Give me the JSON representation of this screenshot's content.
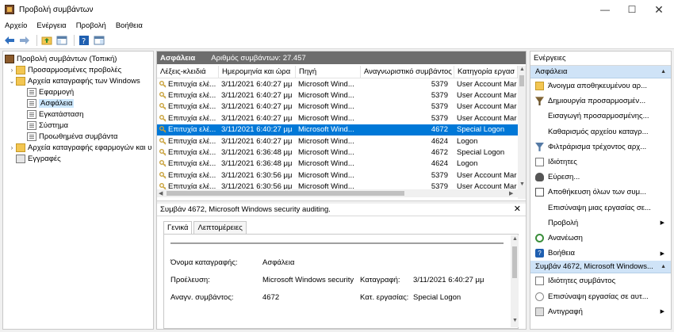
{
  "window": {
    "title": "Προβολή συμβάντων"
  },
  "menu": [
    "Αρχείο",
    "Ενέργεια",
    "Προβολή",
    "Βοήθεια"
  ],
  "tree": [
    {
      "label": "Προβολή συμβάντων (Τοπική)",
      "level": 0,
      "expander": "",
      "icon": "root"
    },
    {
      "label": "Προσαρμοσμένες προβολές",
      "level": 1,
      "expander": "›",
      "icon": "folder"
    },
    {
      "label": "Αρχεία καταγραφής των Windows",
      "level": 1,
      "expander": "⌄",
      "icon": "folder"
    },
    {
      "label": "Εφαρμογή",
      "level": 2,
      "expander": "",
      "icon": "log"
    },
    {
      "label": "Ασφάλεια",
      "level": 2,
      "expander": "",
      "icon": "log",
      "selected": true
    },
    {
      "label": "Εγκατάσταση",
      "level": 2,
      "expander": "",
      "icon": "log"
    },
    {
      "label": "Σύστημα",
      "level": 2,
      "expander": "",
      "icon": "log"
    },
    {
      "label": "Προωθημένα συμβάντα",
      "level": 2,
      "expander": "",
      "icon": "log"
    },
    {
      "label": "Αρχεία καταγραφής εφαρμογών και υ",
      "level": 1,
      "expander": "›",
      "icon": "folder"
    },
    {
      "label": "Εγγραφές",
      "level": 1,
      "expander": "",
      "icon": "filter"
    }
  ],
  "log_header": {
    "title": "Ασφάλεια",
    "count": "Αριθμός συμβάντων: 27.457"
  },
  "columns": [
    "Λέξεις-κλειδιά",
    "Ημερομηνία και ώρα",
    "Πηγή",
    "Αναγνωριστικό συμβάντος",
    "Κατηγορία εργασ"
  ],
  "events": [
    {
      "kw": "Επιτυχία ελέ...",
      "dt": "3/11/2021 6:40:27 μμ",
      "src": "Microsoft Wind...",
      "id": "5379",
      "cat": "User Account Mar"
    },
    {
      "kw": "Επιτυχία ελέ...",
      "dt": "3/11/2021 6:40:27 μμ",
      "src": "Microsoft Wind...",
      "id": "5379",
      "cat": "User Account Mar"
    },
    {
      "kw": "Επιτυχία ελέ...",
      "dt": "3/11/2021 6:40:27 μμ",
      "src": "Microsoft Wind...",
      "id": "5379",
      "cat": "User Account Mar"
    },
    {
      "kw": "Επιτυχία ελέ...",
      "dt": "3/11/2021 6:40:27 μμ",
      "src": "Microsoft Wind...",
      "id": "5379",
      "cat": "User Account Mar"
    },
    {
      "kw": "Επιτυχία ελέ...",
      "dt": "3/11/2021 6:40:27 μμ",
      "src": "Microsoft Wind...",
      "id": "4672",
      "cat": "Special Logon",
      "selected": true
    },
    {
      "kw": "Επιτυχία ελέ...",
      "dt": "3/11/2021 6:40:27 μμ",
      "src": "Microsoft Wind...",
      "id": "4624",
      "cat": "Logon"
    },
    {
      "kw": "Επιτυχία ελέ...",
      "dt": "3/11/2021 6:36:48 μμ",
      "src": "Microsoft Wind...",
      "id": "4672",
      "cat": "Special Logon"
    },
    {
      "kw": "Επιτυχία ελέ...",
      "dt": "3/11/2021 6:36:48 μμ",
      "src": "Microsoft Wind...",
      "id": "4624",
      "cat": "Logon"
    },
    {
      "kw": "Επιτυχία ελέ...",
      "dt": "3/11/2021 6:30:56 μμ",
      "src": "Microsoft Wind...",
      "id": "5379",
      "cat": "User Account Mar"
    },
    {
      "kw": "Επιτυχία ελέ...",
      "dt": "3/11/2021 6:30:56 μμ",
      "src": "Microsoft Wind...",
      "id": "5379",
      "cat": "User Account Mar"
    }
  ],
  "detail": {
    "title": "Συμβάν 4672, Microsoft Windows security auditing.",
    "tabs": [
      "Γενικά",
      "Λεπτομέρειες"
    ],
    "fields": {
      "logname_label": "Όνομα καταγραφής:",
      "logname_value": "Ασφάλεια",
      "source_label": "Προέλευση:",
      "source_value": "Microsoft Windows security a",
      "logged_label": "Καταγραφή:",
      "logged_value": "3/11/2021 6:40:27 μμ",
      "eventid_label": "Αναγν. συμβάντος:",
      "eventid_value": "4672",
      "category_label": "Κατ. εργασίας:",
      "category_value": "Special Logon"
    }
  },
  "actions": {
    "title": "Ενέργειες",
    "section1": "Ασφάλεια",
    "items1": [
      {
        "label": "Άνοιγμα αποθηκευμένου αρ...",
        "icon": "open",
        "more": false
      },
      {
        "label": "Δημιουργία προσαρμοσμέν...",
        "icon": "filt",
        "more": false
      },
      {
        "label": "Εισαγωγή προσαρμοσμένης...",
        "icon": "blank",
        "more": false
      },
      {
        "label": "Καθαρισμός αρχείου καταγρ...",
        "icon": "blank",
        "more": false
      },
      {
        "label": "Φιλτράρισμα τρέχοντος αρχ...",
        "icon": "filt2",
        "more": false
      },
      {
        "label": "Ιδιότητες",
        "icon": "props",
        "more": false
      },
      {
        "label": "Εύρεση...",
        "icon": "find",
        "more": false
      },
      {
        "label": "Αποθήκευση όλων των συμ...",
        "icon": "save",
        "more": false
      },
      {
        "label": "Επισύναψη μιας εργασίας σε...",
        "icon": "blank",
        "more": false
      },
      {
        "label": "Προβολή",
        "icon": "blank",
        "more": true
      },
      {
        "label": "Ανανέωση",
        "icon": "refresh",
        "more": false
      },
      {
        "label": "Βοήθεια",
        "icon": "help",
        "more": true
      }
    ],
    "section2": "Συμβάν 4672, Microsoft Windows...",
    "items2": [
      {
        "label": "Ιδιότητες συμβάντος",
        "icon": "props",
        "more": false
      },
      {
        "label": "Επισύναψη εργασίας σε αυτ...",
        "icon": "task",
        "more": false
      },
      {
        "label": "Αντιγραφή",
        "icon": "copy",
        "more": true
      }
    ]
  }
}
